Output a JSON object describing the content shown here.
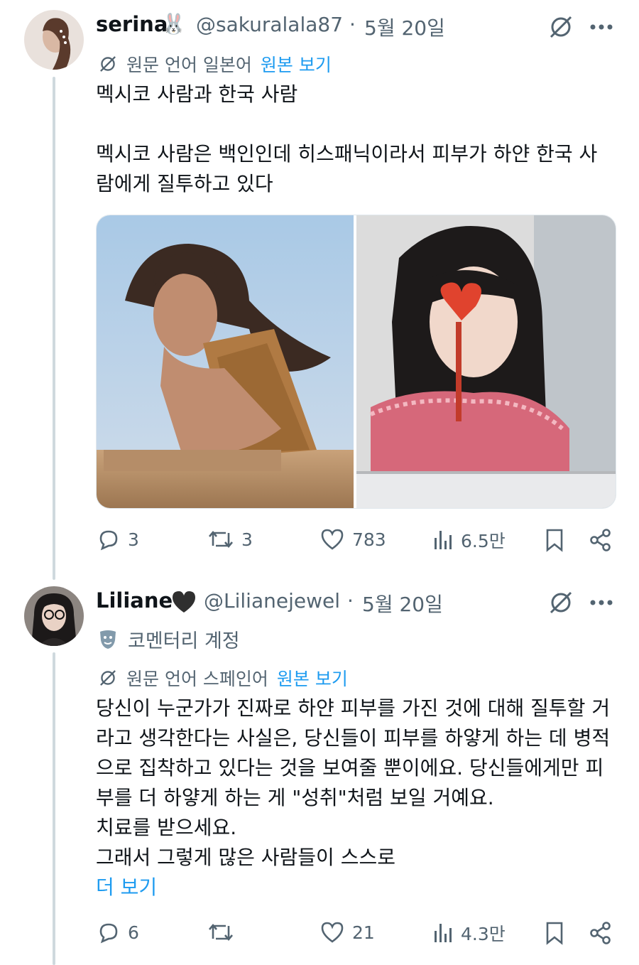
{
  "tweet1": {
    "display_name": "serina",
    "name_emoji": "🐰",
    "handle": "@sakuralala87",
    "separator": "·",
    "date": "5월 20일",
    "translation_note": "원문 언어 일본어",
    "view_original": "원본 보기",
    "text_lines": [
      "멕시코 사람과 한국 사람",
      "",
      "멕시코 사람은 백인인데 히스패닉이라서 피부가 하얀 한국 사",
      "람에게 질투하고 있다"
    ],
    "actions": {
      "replies": "3",
      "reposts": "3",
      "likes": "783",
      "views": "6.5만"
    }
  },
  "tweet2": {
    "display_name": "Liliane",
    "handle": "@Lilianejewel",
    "separator": "·",
    "date": "5월 20일",
    "account_label": "코멘터리 계정",
    "translation_note": "원문 언어 스페인어",
    "view_original": "원본 보기",
    "text_lines": [
      "당신이 누군가가 진짜로 하얀 피부를 가진 것에 대해 질투할 거",
      "라고 생각한다는 사실은, 당신들이 피부를 하얗게 하는 데 병적",
      "으로 집착하고 있다는 것을 보여줄 뿐이에요. 당신들에게만 피",
      "부를 더 하얗게 하는 게 \"성취\"처럼 보일 거예요.",
      "치료를 받으세요.",
      "그래서 그렇게 많은 사람들이 스스로"
    ],
    "show_more": "더 보기",
    "actions": {
      "replies": "6",
      "reposts": "",
      "likes": "21",
      "views": "4.3만"
    }
  },
  "colors": {
    "accent": "#1d9bf0",
    "text": "#0f1419",
    "muted": "#536471",
    "thread": "#cfd9de"
  },
  "icons": [
    "grok-icon",
    "more-icon",
    "translate-icon",
    "reply-icon",
    "repost-icon",
    "like-icon",
    "views-icon",
    "bookmark-icon",
    "share-icon",
    "heart-badge-icon",
    "mask-icon"
  ]
}
